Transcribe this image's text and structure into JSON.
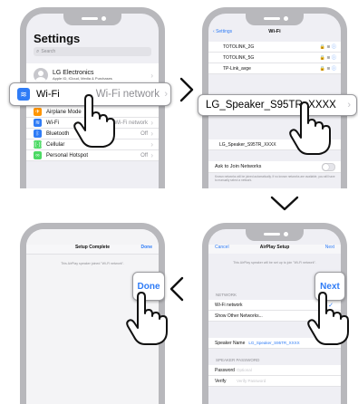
{
  "settings": {
    "title": "Settings",
    "search_placeholder": "Search",
    "account_name": "LG Electronics",
    "account_sub": "Apple ID, iCloud, Media & Purchases",
    "airplane": "Airplane Mode",
    "wifi": "Wi-Fi",
    "wifi_value": "Wi-Fi network",
    "bluetooth": "Bluetooth",
    "bluetooth_value": "Off",
    "cellular": "Cellular",
    "hotspot": "Personal Hotspot",
    "hotspot_value": "Off",
    "callout_label": "Wi-Fi",
    "callout_value": "Wi-Fi network"
  },
  "wifi_screen": {
    "back": "Settings",
    "title": "Wi-Fi",
    "networks": [
      "TOTOLINK_2G",
      "TOTOLINK_5G",
      "TP-Link_avge"
    ],
    "airplay_header": "SET UP NEW AIRPLAY SPEAKER...",
    "speaker_small": "LG_Speaker_S95TR_XXXX",
    "callout_speaker": "LG_Speaker_S95TR_XXXX",
    "ask_join": "Ask to Join Networks",
    "ask_join_note": "Known networks will be joined automatically. If no known networks are available, you will have to manually select a network."
  },
  "airplay_setup": {
    "cancel": "Cancel",
    "title": "AirPlay Setup",
    "next": "Next",
    "description": "This AirPlay speaker will be set up to join \"Wi-Fi network\".",
    "network_header": "NETWORK",
    "wifi_network": "Wi-Fi network",
    "show_other": "Show Other Networks...",
    "speaker_name_label": "Speaker Name",
    "speaker_name_value": "LG_Speaker_S95TR_XXXX",
    "password_header": "SPEAKER PASSWORD",
    "password_label": "Password",
    "password_placeholder": "Optional",
    "verify_label": "Verify",
    "verify_placeholder": "Verify Password",
    "callout_next": "Next"
  },
  "setup_complete": {
    "title": "Setup Complete",
    "done": "Done",
    "message": "This AirPlay speaker joined \"Wi-Fi network\".",
    "callout_done": "Done"
  },
  "colors": {
    "accent": "#2f7cf6",
    "wifi_icon": "#2f7cf6",
    "bluetooth_icon": "#2f7cf6",
    "cellular_icon": "#4cd964",
    "hotspot_icon": "#4cd964",
    "airplane_icon": "#ff9500",
    "check": "#2f7cf6"
  },
  "icons": [
    "wifi-icon",
    "bluetooth-icon",
    "cellular-icon",
    "hotspot-icon",
    "airplane-icon",
    "pointing-hand-icon",
    "chevron-right-icon",
    "chevron-down-icon",
    "chevron-left-icon",
    "lock-icon",
    "info-icon",
    "checkmark-icon"
  ]
}
